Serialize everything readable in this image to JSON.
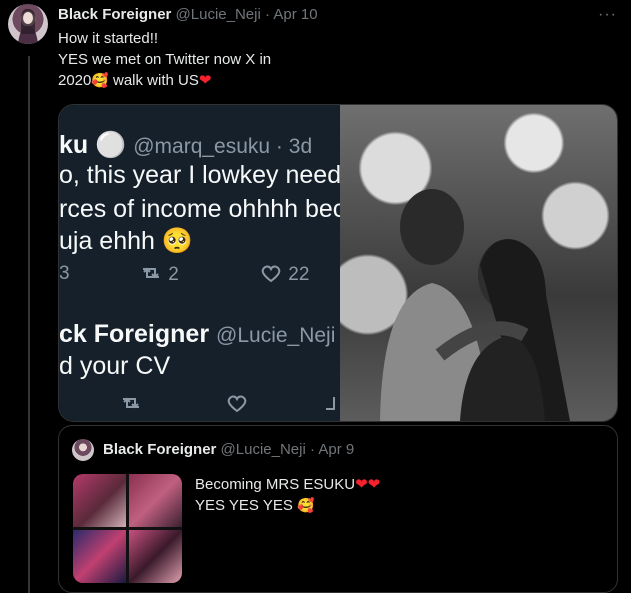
{
  "tweet": {
    "author_name": "Black Foreigner",
    "author_handle": "@Lucie_Neji",
    "separator": "·",
    "date": "Apr 10",
    "lines": [
      "How it started!!",
      "YES we met on Twitter now X in",
      "2020"
    ],
    "line3_suffix": " walk with US",
    "more_label": "···"
  },
  "screenshot": {
    "row1_name": "ku",
    "row1_handle": "@marq_esuku · 3d",
    "row2": "o, this year  I lowkey need",
    "row3": "rces of income ohhhh bec",
    "row4": "uja ehhh",
    "reply_count": "3",
    "retweet_count": "2",
    "like_count": "22",
    "reply2_name": "ck Foreigner",
    "reply2_handle": "@Lucie_Neji",
    "reply2_text": "d your CV"
  },
  "quote": {
    "author_name": "Black Foreigner",
    "author_handle": "@Lucie_Neji",
    "separator": "·",
    "date": "Apr 9",
    "line1": "Becoming MRS ESUKU",
    "line2": "YES YES YES"
  },
  "colors": {
    "background": "#000000",
    "text": "#e7e9ea",
    "muted": "#71767b",
    "heart": "#f4212e"
  }
}
